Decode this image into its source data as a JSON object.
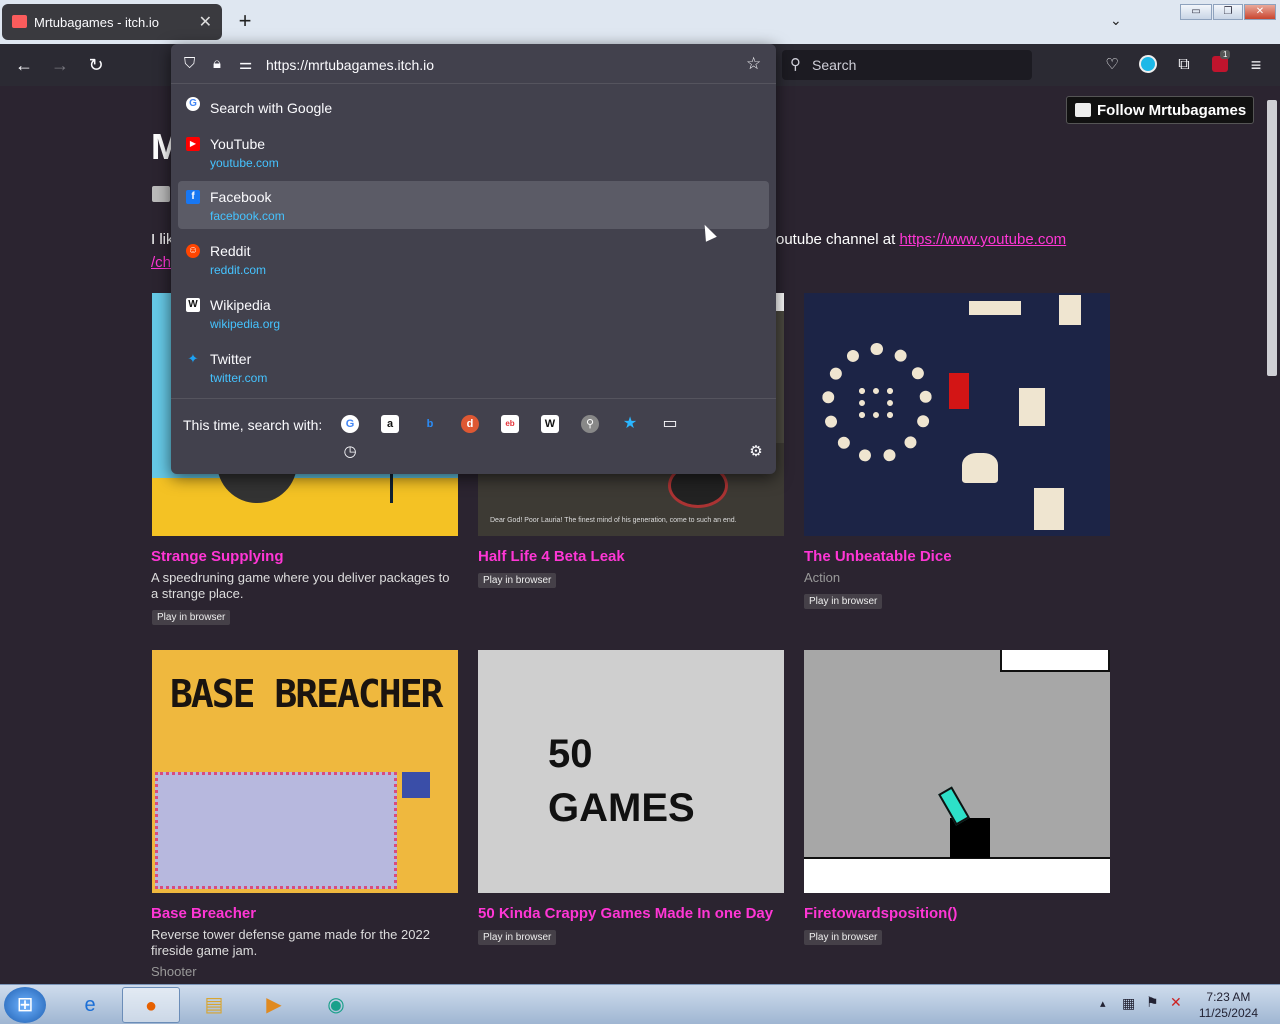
{
  "tab": {
    "title": "Mrtubagames - itch.io",
    "close": "✕"
  },
  "newtab": "+",
  "address": {
    "url": "https://mrtubagames.itch.io"
  },
  "search": {
    "placeholder": "Search"
  },
  "profile": {
    "follow_label": "Follow Mrtubagames",
    "heading_partial": "M"
  },
  "page_text": {
    "desc_left": "I lik",
    "desc_right": "outube channel at ",
    "link1": "https://www.youtube.com",
    "link2": "/ch"
  },
  "dropdown": {
    "suggestions": [
      {
        "name": "Search with Google",
        "domain": ""
      },
      {
        "name": "YouTube",
        "domain": "youtube.com"
      },
      {
        "name": "Facebook",
        "domain": "facebook.com"
      },
      {
        "name": "Reddit",
        "domain": "reddit.com"
      },
      {
        "name": "Wikipedia",
        "domain": "wikipedia.org"
      },
      {
        "name": "Twitter",
        "domain": "twitter.com"
      }
    ],
    "engines_label": "This time, search with:"
  },
  "games": [
    {
      "title": "Strange Supplying",
      "desc": "A speedruning game where you deliver packages to a strange place.",
      "tag": "Play in browser",
      "genre": ""
    },
    {
      "title": "Half Life 4 Beta Leak",
      "desc": "",
      "tag": "Play in browser",
      "genre": "",
      "caption": "Dear God! Poor Lauria!  The finest mind of his generation, come to such an end."
    },
    {
      "title": "The Unbeatable Dice",
      "desc": "",
      "tag": "Play in browser",
      "genre": "Action"
    },
    {
      "title": "Base Breacher",
      "desc": "Reverse tower defense game made for the 2022 fireside game jam.",
      "tag": "",
      "genre": "Shooter",
      "art": "BASE BREACHER"
    },
    {
      "title": "50 Kinda Crappy Games Made In one Day",
      "desc": "",
      "tag": "Play in browser",
      "genre": "",
      "art1": "50",
      "art2": "GAMES"
    },
    {
      "title": "Firetowardsposition()",
      "desc": "",
      "tag": "Play in browser",
      "genre": ""
    }
  ],
  "clock": {
    "time": "7:23 AM",
    "date": "11/25/2024"
  },
  "notification_count": "1"
}
